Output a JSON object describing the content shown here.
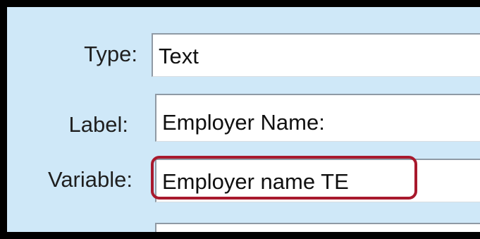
{
  "form": {
    "type_label": "Type:",
    "type_value": "Text",
    "label_label": "Label:",
    "label_value": "Employer Name:",
    "variable_label": "Variable:",
    "variable_value": "Employer name TE",
    "next_value": ""
  },
  "colors": {
    "panel_background": "#cfe8f8",
    "highlight_border": "#a8192d",
    "frame": "#000000"
  }
}
